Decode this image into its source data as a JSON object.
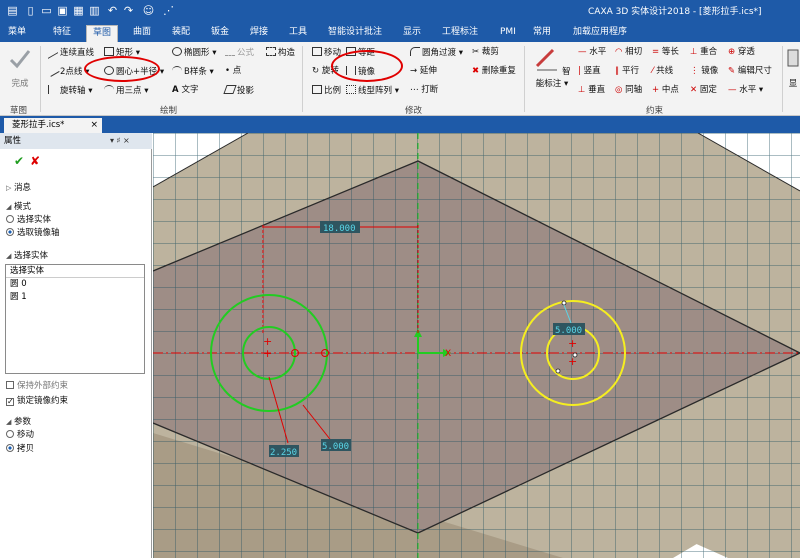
{
  "titlebar": {
    "title": "CAXA 3D 实体设计2018 - [菱形拉手.ics*]"
  },
  "menu": {
    "tabs": [
      "菜单",
      "特征",
      "草图",
      "曲面",
      "装配",
      "钣金",
      "焊接",
      "工具",
      "智能设计批注",
      "显示",
      "工程标注",
      "PMI",
      "常用",
      "加载应用程序"
    ],
    "active_index": 2
  },
  "ribbon": {
    "finish_label": "完成",
    "sketch_group": "草图",
    "draw_group": "绘制",
    "modify_group": "修改",
    "constraint_group": "约束",
    "show_label": "显",
    "draw": {
      "line": "连续直线",
      "rect": "矩形",
      "ellipse": "椭圆形",
      "formula": "公式",
      "construct": "构造",
      "two_point_line": "2点线",
      "circle": "圆心+半径",
      "bspline": "B样条",
      "point": "点",
      "rotate_axis": "旋转轴",
      "three_point_arc": "用三点",
      "text": "文字",
      "project": "投影"
    },
    "modify": {
      "move": "移动",
      "offset": "等距",
      "fillet": "圆角过渡",
      "trim": "裁剪",
      "rotate": "旋转",
      "mirror": "镜像",
      "extend": "延伸",
      "delete_dup": "删除重复",
      "scale": "比例",
      "linear_array": "线型阵列",
      "break": "打断"
    },
    "constraint": {
      "smart_dim": "智能标注",
      "horizontal": "水平",
      "tangent": "相切",
      "equal_len": "等长",
      "coincident": "重合",
      "pierce": "穿透",
      "vertical": "竖直",
      "parallel": "平行",
      "collinear": "共线",
      "mirror": "镜像",
      "edit_dim": "编辑尺寸",
      "perpendicular": "垂直",
      "concentric": "同轴",
      "midpoint": "中点",
      "fixed": "固定",
      "horizontal2": "水平"
    }
  },
  "doc_tab": {
    "label": "菱形拉手.ics*",
    "close": "×"
  },
  "panel": {
    "title": "属性",
    "pin": "▾ ♯ ×",
    "ok_icon": "✔",
    "cancel_icon": "✘",
    "message": "消息",
    "mode_header": "模式",
    "mode_options": [
      "选择实体",
      "选取镜像轴"
    ],
    "mode_selected": 1,
    "select_header": "选择实体",
    "list_header": "选择实体",
    "list_items": [
      "圆 0",
      "圆 1"
    ],
    "keep_external": "保持外部约束",
    "lock_mirror": "锁定镜像约束",
    "params_header": "参数",
    "param_options": [
      "移动",
      "拷贝"
    ],
    "param_selected": 1
  },
  "canvas": {
    "dim_top": "18.000",
    "dim_right": "5.000",
    "dim_left_small": "2.250",
    "dim_left_large": "5.000",
    "axis_x_label": "X"
  },
  "colors": {
    "titlebar": "#1e5aa8",
    "canvas_bg": "#ffffff",
    "face": "#9e8d86",
    "bevel": "#bdb39e",
    "grid": "#1f4f5f",
    "green": "#22cc22",
    "yellow": "#f5ee20",
    "red": "#e00000",
    "dim_bg": "#2f5560",
    "dim_text": "#59d6e8"
  }
}
